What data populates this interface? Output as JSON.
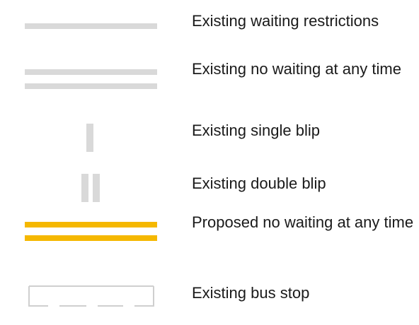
{
  "legend": {
    "items": [
      {
        "symbol": "single-grey-line",
        "label": "Existing waiting restrictions"
      },
      {
        "symbol": "double-grey-line",
        "label": "Existing no waiting at any time"
      },
      {
        "symbol": "single-grey-blip",
        "label": "Existing single blip"
      },
      {
        "symbol": "double-grey-blip",
        "label": "Existing double blip"
      },
      {
        "symbol": "double-yellow-line",
        "label": "Proposed no waiting at any time"
      },
      {
        "symbol": "bus-stop-marking",
        "label": "Existing bus stop"
      }
    ]
  },
  "colors": {
    "existing": "#d9d9d9",
    "proposed": "#f5b800",
    "bus_stop_outline": "#cfcfcf"
  }
}
